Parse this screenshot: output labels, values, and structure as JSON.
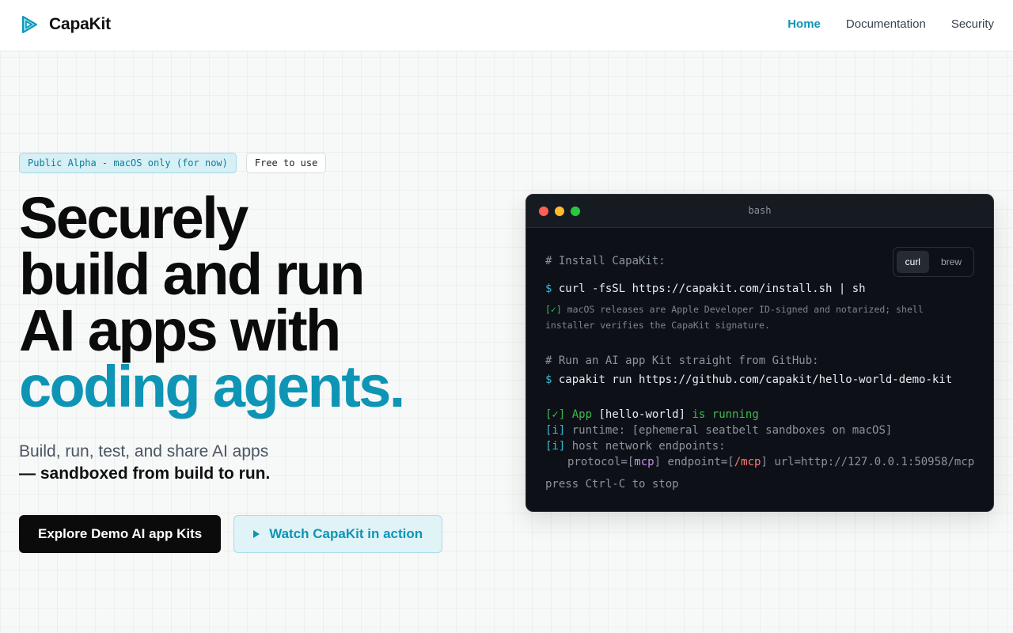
{
  "header": {
    "brand": "CapaKit",
    "nav": [
      {
        "label": "Home",
        "active": true
      },
      {
        "label": "Documentation",
        "active": false
      },
      {
        "label": "Security",
        "active": false
      }
    ]
  },
  "hero": {
    "badge_alpha": "Public Alpha - macOS only (for now)",
    "badge_free": "Free to use",
    "headline_lines": [
      "Securely",
      "build and run",
      "AI apps with"
    ],
    "headline_accent": "coding agents.",
    "subtitle_line1": "Build, run, test, and share AI apps",
    "subtitle_line2": "— sandboxed from build to run.",
    "cta_primary": "Explore Demo AI app Kits",
    "cta_secondary": "Watch CapaKit in action"
  },
  "terminal": {
    "title": "bash",
    "tabs": [
      {
        "label": "curl",
        "active": true
      },
      {
        "label": "brew",
        "active": false
      }
    ],
    "install_comment": "# Install CapaKit:",
    "prompt": "$",
    "install_cmd": "curl -fsSL https://capakit.com/install.sh | sh",
    "note_check": "[✓]",
    "note_text": "macOS releases are Apple Developer ID-signed and notarized; shell installer verifies the CapaKit signature.",
    "run_comment": "# Run an AI app Kit straight from GitHub:",
    "run_cmd": "capakit run https://github.com/capakit/hello-world-demo-kit",
    "status_check": "[✓]",
    "status_app": "App",
    "status_name": "[hello-world]",
    "status_running": "is running",
    "info_tag": "[i]",
    "runtime_label": "runtime:",
    "runtime_value": "[ephemeral seatbelt sandboxes on macOS]",
    "endpoints_label": "host network endpoints:",
    "ep_protocol_key": "protocol=[",
    "ep_protocol_val": "mcp",
    "ep_endpoint_key": "] endpoint=[",
    "ep_endpoint_val": "/mcp",
    "ep_url": "] url=http://127.0.0.1:50958/mcp",
    "stop_hint": "press Ctrl-C to stop"
  },
  "colors": {
    "accent": "#0e95b5",
    "terminal_bg": "#0d1117",
    "ok_green": "#3fb950"
  }
}
